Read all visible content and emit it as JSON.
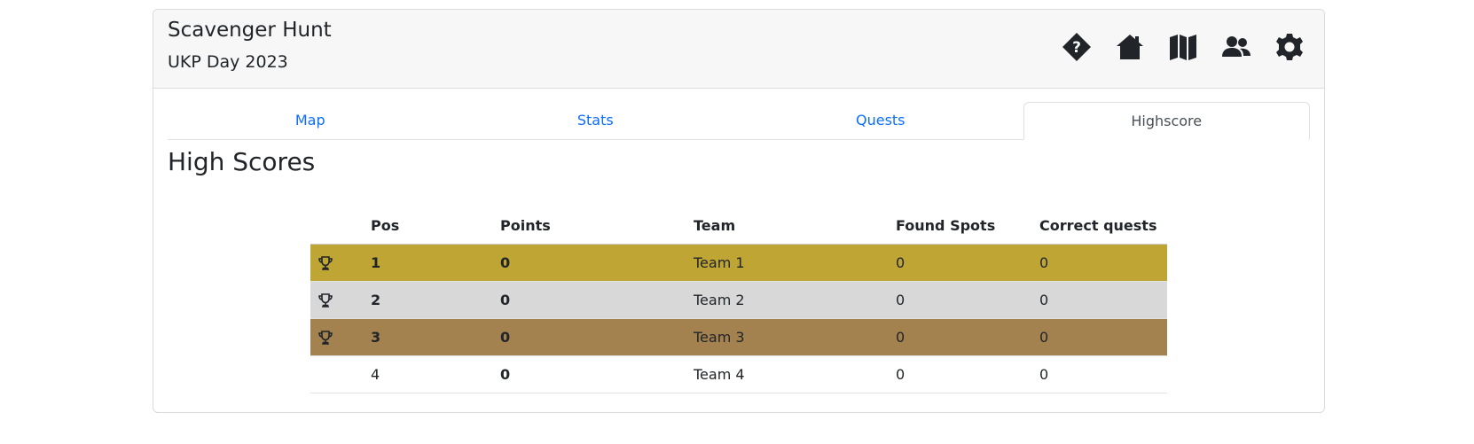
{
  "header": {
    "title": "Scavenger Hunt",
    "subtitle": "UKP Day 2023",
    "icons": [
      "help-icon",
      "home-icon",
      "map-icon",
      "team-icon",
      "settings-icon"
    ]
  },
  "tabs": [
    {
      "label": "Map",
      "active": false
    },
    {
      "label": "Stats",
      "active": false
    },
    {
      "label": "Quests",
      "active": false
    },
    {
      "label": "Highscore",
      "active": true
    }
  ],
  "heading": "High Scores",
  "table": {
    "columns": [
      "",
      "Pos",
      "Points",
      "Team",
      "Found Spots",
      "Correct quests"
    ],
    "rows": [
      {
        "trophy": true,
        "pos": "1",
        "points": "0",
        "team": "Team 1",
        "found": "0",
        "correct": "0",
        "color": "#bfa533"
      },
      {
        "trophy": true,
        "pos": "2",
        "points": "0",
        "team": "Team 2",
        "found": "0",
        "correct": "0",
        "color": "#d8d8d8"
      },
      {
        "trophy": true,
        "pos": "3",
        "points": "0",
        "team": "Team 3",
        "found": "0",
        "correct": "0",
        "color": "#a38250"
      },
      {
        "trophy": false,
        "pos": "4",
        "points": "0",
        "team": "Team 4",
        "found": "0",
        "correct": "0",
        "color": "#ffffff"
      }
    ]
  }
}
